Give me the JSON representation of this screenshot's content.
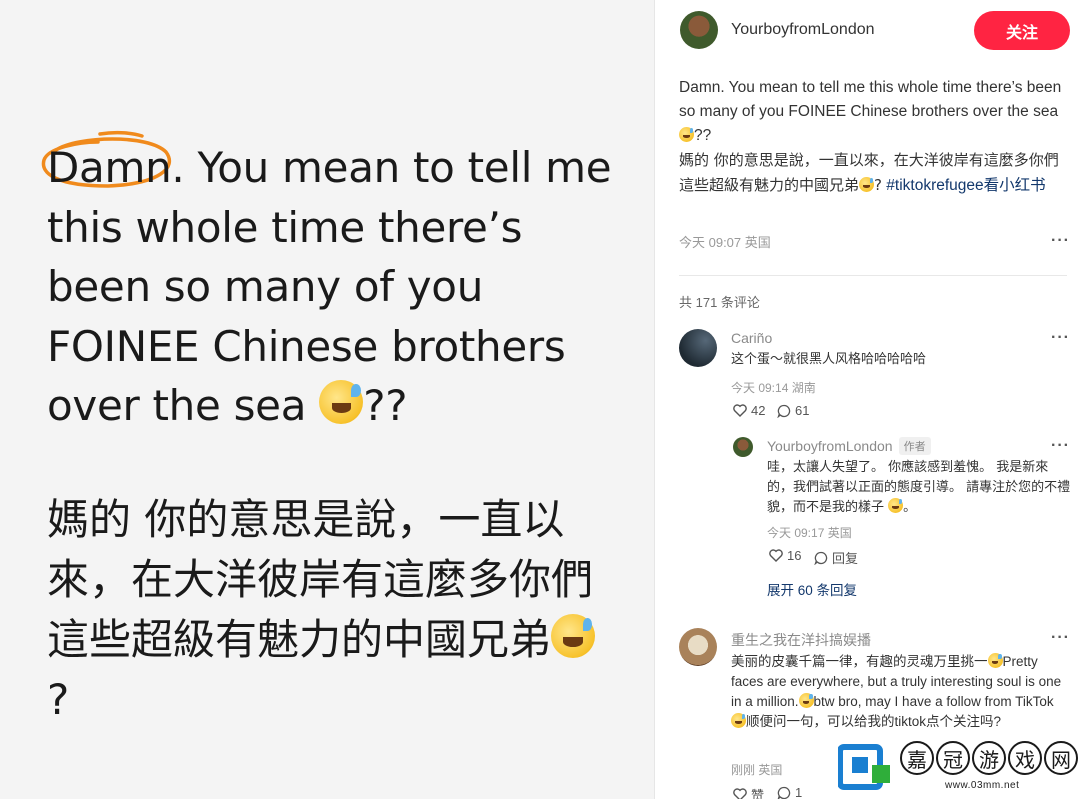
{
  "image_panel": {
    "english_text": "Damn. You mean to tell me this whole time there’s been so many of you FOINEE Chinese brothers over the sea",
    "english_tail": "??",
    "chinese_text": "媽的 你的意思是說，一直以來，在大洋彼岸有這麼多你們這些超級有魅力的中國兄弟",
    "chinese_tail": "?",
    "emoji_icon": "grinning-sweat-emoji"
  },
  "author": {
    "name": "YourboyfromLondon",
    "follow_label": "关注"
  },
  "post": {
    "english": "Damn. You mean to tell me this whole time there’s been so many of you FOINEE Chinese brothers over the sea",
    "english_tail": "??",
    "chinese": "媽的 你的意思是說，一直以來，在大洋彼岸有這麼多你們這些超級有魅力的中國兄弟",
    "chinese_tail": "?",
    "hashtag": "#tiktokrefugee看小红书",
    "time": "今天 09:07 英国",
    "more": "···"
  },
  "comments_header": {
    "count_label": "共 171 条评论"
  },
  "comments": [
    {
      "author": "Cariño",
      "text": "这个蛋～就很黑人风格哈哈哈哈哈",
      "meta": "今天 09:14 湖南",
      "likes": "42",
      "replies": "61",
      "more": "···"
    },
    {
      "author": "重生之我在洋抖搞娱播",
      "text_1": "美丽的皮囊千篇一律，有趣的灵魂万里挑一",
      "text_2": "Pretty faces are everywhere, but a truly interesting soul is one in a million.",
      "text_3": "btw bro, may I have a follow from TikTok",
      "text_4": "顺便问一句，可以给我的tiktok点个关注吗?",
      "meta": "刚刚 英国",
      "likes": "赞",
      "replies": "1",
      "more": "···"
    }
  ],
  "reply": {
    "author": "YourboyfromLondon",
    "tag": "作者",
    "text": "哇，太讓人失望了。 你應該感到羞愧。 我是新來的，我們試著以正面的態度引導。 請專注於您的不禮貌，而不是我的樣子",
    "meta": "今天 09:17 英国",
    "likes": "16",
    "reply_label": "回复",
    "more": "···",
    "expand_label": "展开 60 条回复"
  },
  "watermark": {
    "chars": [
      "嘉",
      "冠",
      "游",
      "戏",
      "网"
    ],
    "url": "www.03mm.net"
  },
  "colors": {
    "accent": "#ff2442",
    "link": "#13386c",
    "muted": "#999999"
  }
}
